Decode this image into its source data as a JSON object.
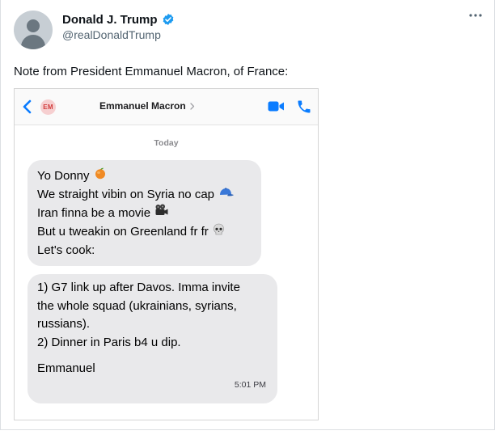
{
  "author": {
    "name": "Donald J. Trump",
    "handle": "@realDonaldTrump"
  },
  "tweet": {
    "text": "Note from President Emmanuel Macron, of France:"
  },
  "imessage": {
    "contact_initials": "EM",
    "contact_name": "Emmanuel Macron",
    "day_label": "Today",
    "message1": {
      "lines": [
        "Yo Donny",
        "We straight vibin on Syria no cap",
        "Iran finna be a movie",
        "But u tweakin on Greenland fr fr",
        "Let's cook:"
      ]
    },
    "message2": {
      "lines": [
        "1) G7 link up after Davos. Imma invite",
        "the whole squad (ukrainians, syrians,",
        "russians).",
        "2) Dinner in Paris b4 u dip."
      ],
      "signoff": "Emmanuel",
      "time": "5:01 PM"
    }
  },
  "icons": [
    "verified-badge-icon",
    "more-options-icon",
    "back-chevron-icon",
    "contact-avatar",
    "chevron-right-icon",
    "video-call-icon",
    "phone-call-icon",
    "orange-emoji",
    "cap-emoji",
    "movie-camera-emoji",
    "skull-emoji"
  ],
  "colors": {
    "accent_blue": "#1d9bf0",
    "imessage_blue": "#0a7cff",
    "bubble_gray": "#e9e9eb"
  }
}
